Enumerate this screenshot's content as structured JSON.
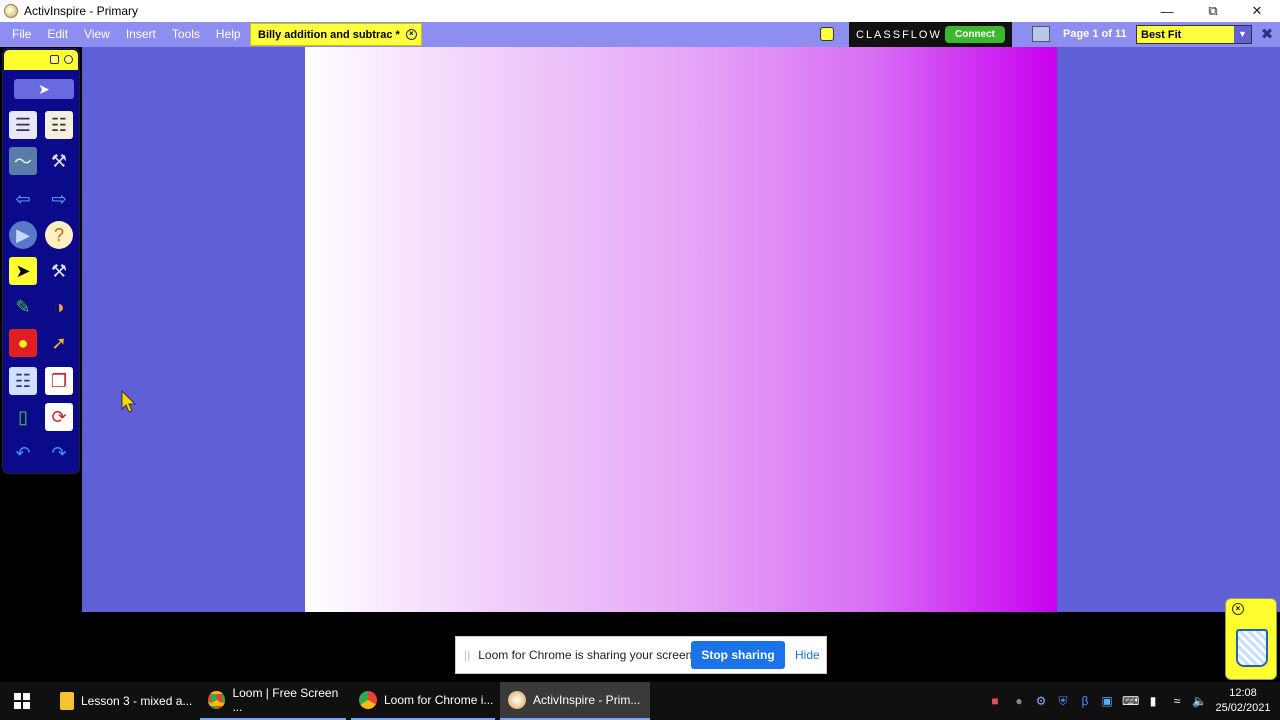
{
  "window": {
    "title": "ActivInspire - Primary"
  },
  "menubar": {
    "items": [
      "File",
      "Edit",
      "View",
      "Insert",
      "Tools",
      "Help"
    ],
    "doc_tab": "Billy addition and subtrac *",
    "classflow_brand": "CLASSFLOW",
    "connect_label": "Connect",
    "page_label": "Page 1 of 11",
    "zoom_value": "Best Fit"
  },
  "toolbox": {
    "tools": [
      "page-browser-icon",
      "object-browser-icon",
      "annotate-desktop-icon",
      "tools-icon",
      "previous-page-icon",
      "next-page-icon",
      "play-icon",
      "help-icon",
      "select-icon",
      "multi-tool-icon",
      "pen-icon",
      "fill-icon",
      "shape-icon",
      "connector-icon",
      "resource-library-icon",
      "duplicate-icon",
      "eraser-icon",
      "reset-page-icon",
      "undo-icon",
      "redo-icon"
    ],
    "active_tool": "select-icon"
  },
  "loom": {
    "message": "Loom for Chrome is sharing your screen.",
    "stop_label": "Stop sharing",
    "hide_label": "Hide"
  },
  "taskbar": {
    "tasks": [
      {
        "label": "Lesson 3 - mixed a...",
        "icon": "folder-icon"
      },
      {
        "label": "Loom | Free Screen ...",
        "icon": "chrome-icon"
      },
      {
        "label": "Loom for Chrome i...",
        "icon": "chrome-icon"
      },
      {
        "label": "ActivInspire - Prim...",
        "icon": "activinspire-icon"
      }
    ],
    "time": "12:08",
    "date": "25/02/2021"
  },
  "colors": {
    "menubar": "#8e8ef0",
    "canvas": "#5f5fd6",
    "highlight": "#ffff40",
    "page_gradient_end": "#c800f0"
  }
}
